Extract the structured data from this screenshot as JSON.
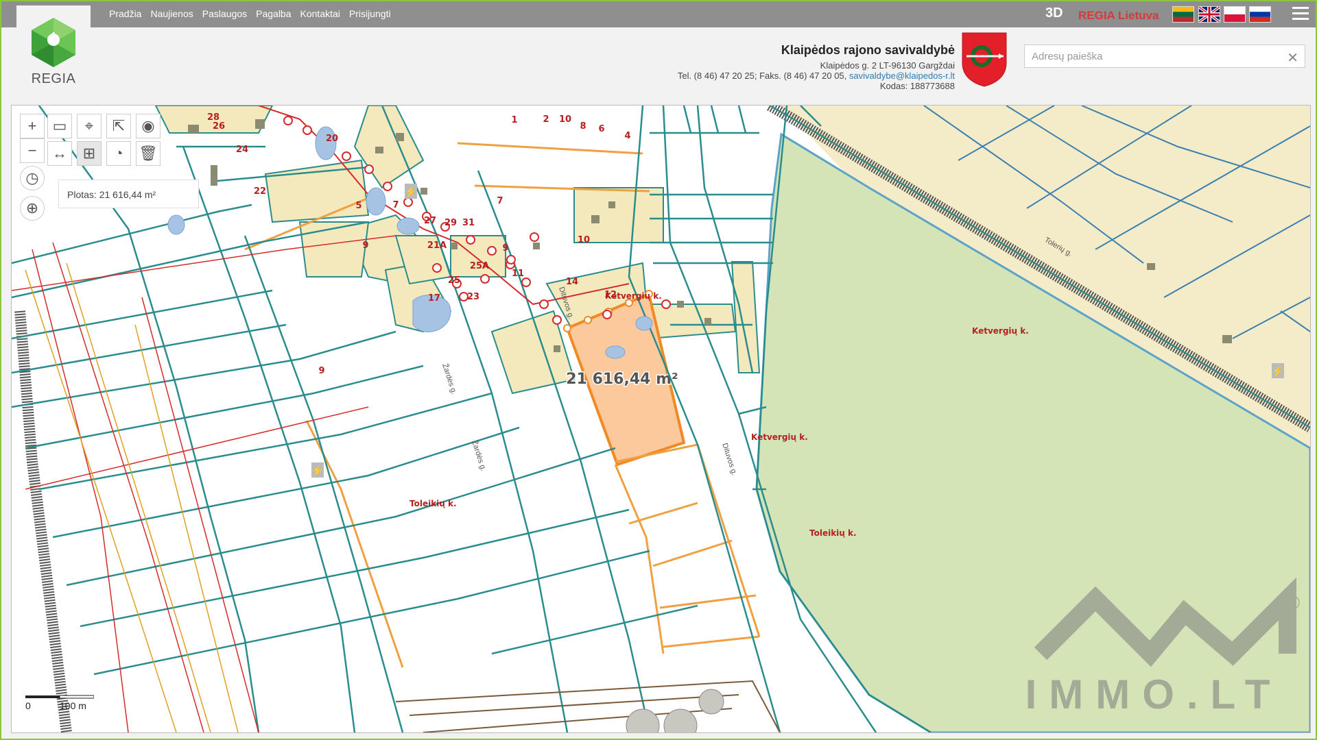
{
  "app": {
    "logo_text": "REGIA",
    "nav": [
      "Pradžia",
      "Naujienos",
      "Paslaugos",
      "Pagalba",
      "Kontaktai",
      "Prisijungti"
    ],
    "btn_3d": "3D",
    "regia_lietuva": "REGIA Lietuva",
    "flags": [
      "lt-flag-icon",
      "gb-flag-icon",
      "pl-flag-icon",
      "ru-flag-icon"
    ]
  },
  "org": {
    "name": "Klaipėdos rajono savivaldybė",
    "address": "Klaipėdos g. 2 LT-96130 Gargždai",
    "phone": "Tel. (8 46) 47 20 25; Faks. (8 46) 47 20 05, ",
    "email": "savivaldybe@klaipedos-r.lt",
    "code": "Kodas: 188773688"
  },
  "search": {
    "placeholder": "Adresų paieška",
    "value": ""
  },
  "map": {
    "area_label": "Plotas: 21 616,44 m²",
    "area_on_map": "21 616,44 m²",
    "scale_start": "0",
    "scale_end": "100 m",
    "watermark": "IMMO.LT",
    "registered": "®",
    "parcel_numbers": [
      "1",
      "2",
      "10",
      "8",
      "6",
      "4",
      "28",
      "26",
      "24",
      "20",
      "22",
      "5",
      "7",
      "27",
      "29",
      "31",
      "7",
      "9",
      "10",
      "21A",
      "25A",
      "9",
      "11",
      "25",
      "17",
      "23",
      "14",
      "12",
      "9"
    ],
    "place_labels": [
      "Ketvergių k.",
      "Ketvergių k.",
      "Ketvergių k.",
      "Toleikių k.",
      "Toleikių k."
    ],
    "street_labels": [
      "Žardės g.",
      "Žardės g.",
      "Dituvos g.",
      "Dituvos g.",
      "Tolerių g."
    ]
  },
  "colors": {
    "accent_green": "#8cc63f",
    "topbar": "#8f8f8f",
    "parcel_line": "#2a8c8c",
    "selected_fill": "#fbc99c",
    "selected_stroke": "#f08a24",
    "forest": "#d5e4b6",
    "building_zone": "#f3e9bd"
  }
}
